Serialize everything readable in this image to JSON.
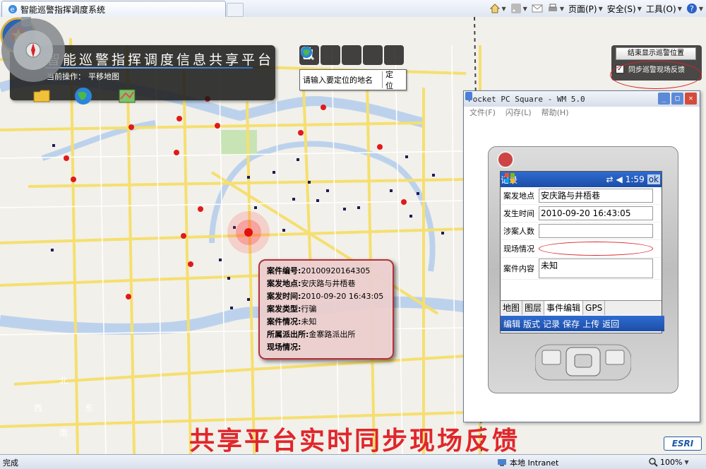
{
  "browser": {
    "tab_title": "智能巡警指挥调度系统",
    "commands": [
      {
        "id": "home",
        "label": ""
      },
      {
        "id": "feeds",
        "label": ""
      },
      {
        "id": "mail",
        "label": ""
      },
      {
        "id": "print",
        "label": ""
      },
      {
        "id": "page",
        "label": "页面(P)"
      },
      {
        "id": "safety",
        "label": "安全(S)"
      },
      {
        "id": "tools",
        "label": "工具(O)"
      },
      {
        "id": "help",
        "label": ""
      }
    ],
    "status_text": "完成",
    "zone": "本地 Intranet",
    "zoom": "100%"
  },
  "app": {
    "title": "智能巡警指挥调度信息共享平台",
    "current_op_label": "当前操作：",
    "current_op_value": "平移地图"
  },
  "locate": {
    "placeholder": "请输入要定位的地名",
    "button": "定 位"
  },
  "sync": {
    "stop_button": "结束显示巡警位置",
    "checkbox_label": "同步巡警现场反馈",
    "checked": true
  },
  "popup": {
    "rows": [
      {
        "k": "案件编号:",
        "v": "20100920164305"
      },
      {
        "k": "案发地点:",
        "v": "安庆路与井梧巷"
      },
      {
        "k": "案发时间:",
        "v": "2010-09-20 16:43:05"
      },
      {
        "k": "案发类型:",
        "v": "行骗"
      },
      {
        "k": "案件情况:",
        "v": "未知"
      },
      {
        "k": "所属派出所:",
        "v": "金寨路派出所"
      },
      {
        "k": "现场情况:",
        "v": ""
      }
    ]
  },
  "pda": {
    "window_title": "Pocket PC Square - WM 5.0",
    "menu": [
      "文件(F)",
      "闪存(L)",
      "帮助(H)"
    ],
    "screen_title": "记录",
    "clock": "1:59",
    "ok": "ok",
    "fields": [
      {
        "label": "案发地点",
        "value": "安庆路与井梧巷"
      },
      {
        "label": "发生时间",
        "value": "2010-09-20 16:43:05"
      },
      {
        "label": "涉案人数",
        "value": ""
      },
      {
        "label": "现场情况",
        "value": ""
      },
      {
        "label": "案件内容",
        "value": "未知"
      }
    ],
    "tabs": [
      "地图",
      "图层",
      "事件编辑",
      "GPS"
    ],
    "bottom": [
      "编辑",
      "版式",
      "记录",
      "保存",
      "上传",
      "返回"
    ]
  },
  "compass": {
    "n": "北",
    "s": "南",
    "e": "东",
    "w": "西"
  },
  "banner": "共享平台实时同步现场反馈",
  "esri": "ESRI",
  "colors": {
    "accent_red": "#e0262b",
    "app_panel": "#1e1e1e",
    "pda_blue": "#2f6bd0"
  }
}
